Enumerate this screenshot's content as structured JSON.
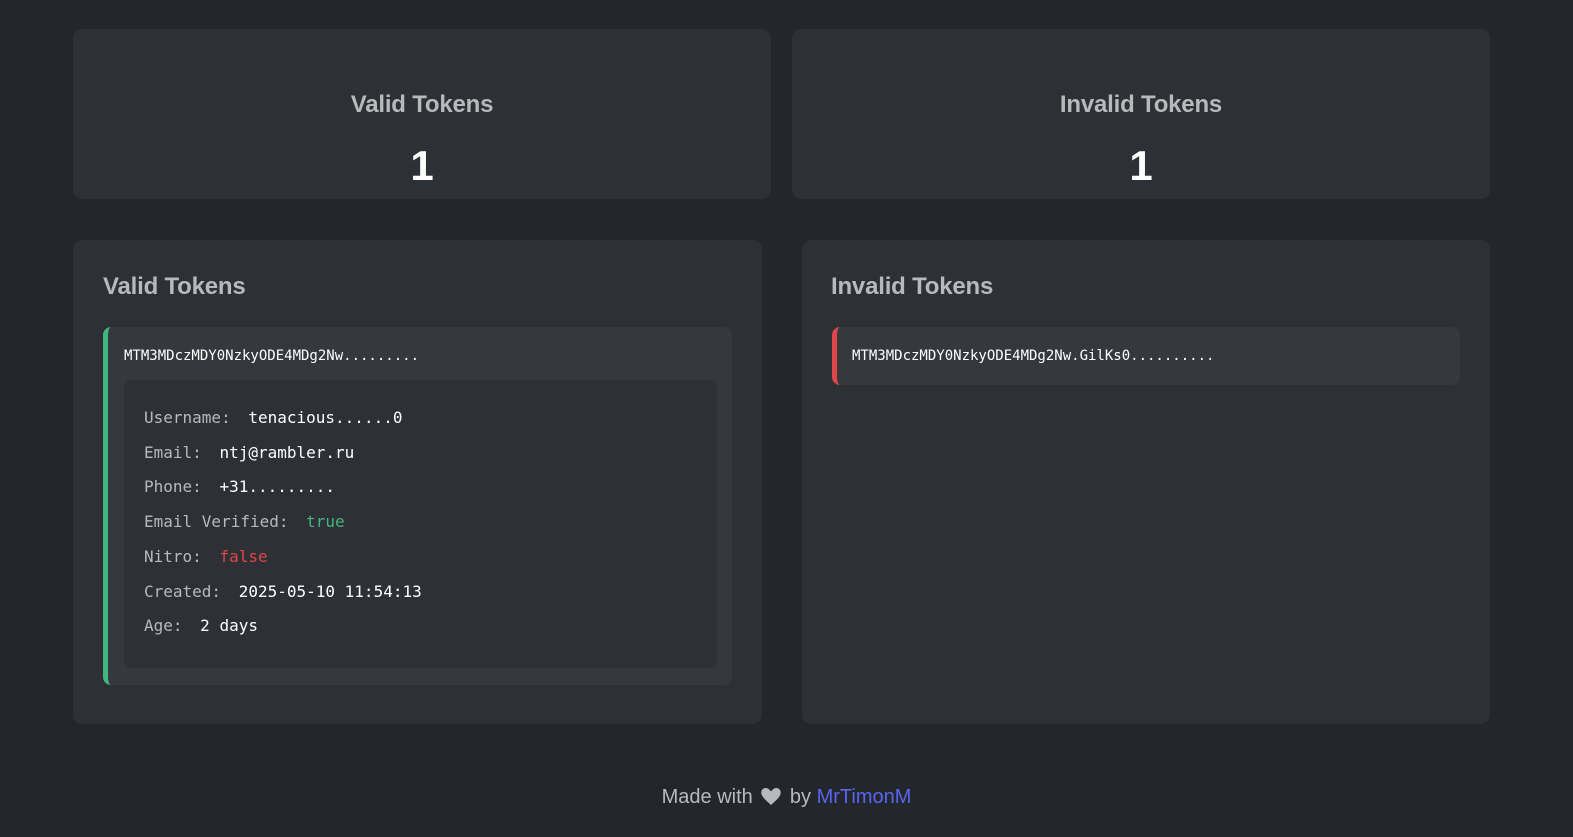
{
  "stats": {
    "valid": {
      "title": "Valid Tokens",
      "count": "1"
    },
    "invalid": {
      "title": "Invalid Tokens",
      "count": "1"
    }
  },
  "panels": {
    "valid": {
      "title": "Valid Tokens",
      "token": "MTM3MDczMDY0NzkyODE4MDg2Nw.........",
      "details": {
        "username_label": "Username:",
        "username_value": "tenacious......0",
        "email_label": "Email:",
        "email_value": "ntj@rambler.ru",
        "phone_label": "Phone:",
        "phone_value": "+31.........",
        "email_verified_label": "Email Verified:",
        "email_verified_value": "true",
        "nitro_label": "Nitro:",
        "nitro_value": "false",
        "created_label": "Created:",
        "created_value": "2025-05-10 11:54:13",
        "age_label": "Age:",
        "age_value": "2 days"
      }
    },
    "invalid": {
      "title": "Invalid Tokens",
      "token": "MTM3MDczMDY0NzkyODE4MDg2Nw.GilKs0.........."
    }
  },
  "footer": {
    "made_with": "Made with",
    "heart_icon": "heart-icon",
    "by": "by",
    "author": "MrTimonM"
  },
  "colors": {
    "background": "#23272b",
    "card": "#2d3035",
    "valid_accent": "#43b581",
    "invalid_accent": "#e0454a",
    "link": "#5865f2"
  }
}
